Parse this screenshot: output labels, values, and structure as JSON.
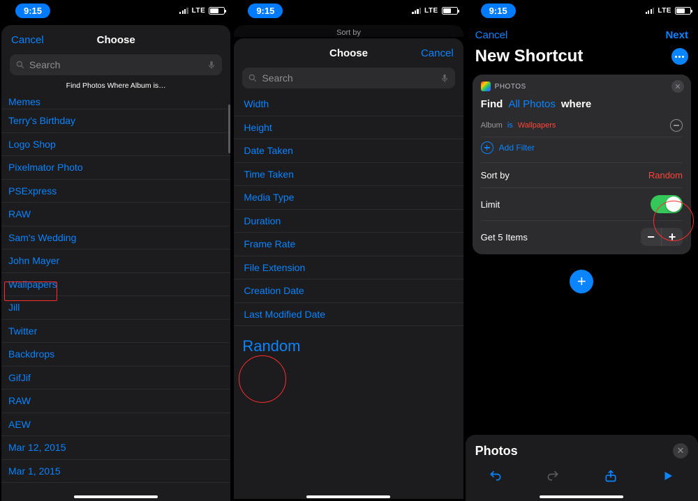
{
  "status": {
    "time": "9:15",
    "carrier": "LTE"
  },
  "panel1": {
    "cancel": "Cancel",
    "title": "Choose",
    "searchPlaceholder": "Search",
    "subtitle": "Find Photos Where Album is…",
    "albums": [
      "Memes",
      "Terry's Birthday",
      "Logo Shop",
      "Pixelmator Photo",
      "PSExpress",
      "RAW",
      "Sam's Wedding",
      "John Mayer",
      "Wallpapers",
      "Jill",
      "Twitter",
      "Backdrops",
      "GifJif",
      "RAW",
      "AEW",
      "Mar 12, 2015",
      "Mar 1, 2015"
    ]
  },
  "panel2": {
    "supertitle": "Sort by",
    "title": "Choose",
    "cancel": "Cancel",
    "searchPlaceholder": "Search",
    "options": [
      "Width",
      "Height",
      "Date Taken",
      "Time Taken",
      "Media Type",
      "Duration",
      "Frame Rate",
      "File Extension",
      "Creation Date",
      "Last Modified Date"
    ],
    "highlighted": "Random"
  },
  "panel3": {
    "cancel": "Cancel",
    "next": "Next",
    "title": "New Shortcut",
    "actionApp": "PHOTOS",
    "find": "Find",
    "allPhotos": "All Photos",
    "where": "where",
    "filterField": "Album",
    "filterOp": "is",
    "filterValue": "Wallpapers",
    "addFilter": "Add Filter",
    "sortByLabel": "Sort by",
    "sortByValue": "Random",
    "limitLabel": "Limit",
    "limitOn": true,
    "getItems": "Get 5 Items",
    "drawerTitle": "Photos"
  }
}
